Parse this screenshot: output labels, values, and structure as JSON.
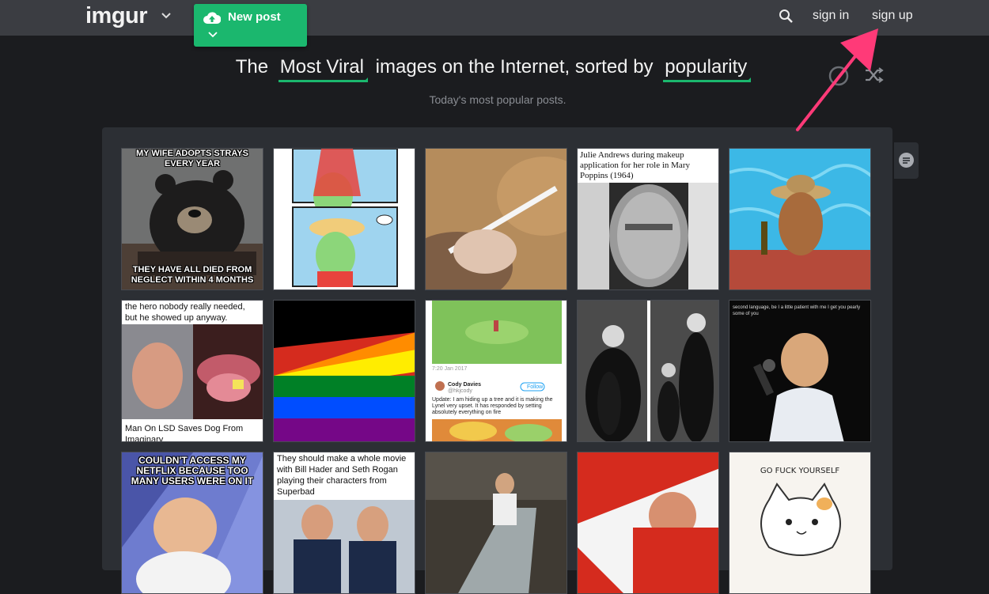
{
  "header": {
    "logo": "imgur",
    "new_post_label": "New post",
    "sign_in": "sign in",
    "sign_up": "sign up",
    "icons": [
      "chevron-down-icon",
      "cloud-upload-icon",
      "search-icon"
    ]
  },
  "headline": {
    "prefix": "The",
    "filter1": "Most Viral",
    "middle": "images on the Internet, sorted by",
    "filter2": "popularity",
    "subtitle": "Today's most popular posts."
  },
  "controls": {
    "icons": [
      "toggle-icon",
      "shuffle-icon",
      "chat-icon"
    ]
  },
  "colors": {
    "accent": "#1bb76e",
    "topbar": "#3b3d42",
    "background": "#1b1c1f",
    "panel": "#2c2f34",
    "annotation": "#ff3a78"
  },
  "tiles": {
    "t1": {
      "top": "MY WIFE ADOPTS STRAYS EVERY YEAR",
      "bottom": "THEY HAVE ALL DIED FROM NEGLECT WITHIN 4 MONTHS"
    },
    "t4": {
      "caption": "Julie Andrews during makeup application for her role in Mary Poppins (1964)"
    },
    "t6": {
      "top": "the hero nobody really needed, but he showed up anyway.",
      "bottom": "Man On LSD Saves Dog From Imaginary"
    },
    "t8": {
      "date": "7:20 Jan 2017",
      "name": "Cody Davies",
      "handle": "@hkjcody",
      "follow": "Follow",
      "text": "Update: I am hiding up a tree and it is making the Lynel very upset. It has responded by setting absolutely everything on fire"
    },
    "t10": {
      "caption": "second language, be I a little patient with me I get you pearly some of you"
    },
    "t11": {
      "caption": "COULDN'T ACCESS MY NETFLIX BECAUSE TOO MANY USERS WERE ON IT"
    },
    "t12": {
      "caption": "They should make a whole movie with Bill Hader and Seth Rogan playing their characters from Superbad"
    },
    "t15": {
      "caption": "GO FUCK YOURSELF"
    }
  }
}
